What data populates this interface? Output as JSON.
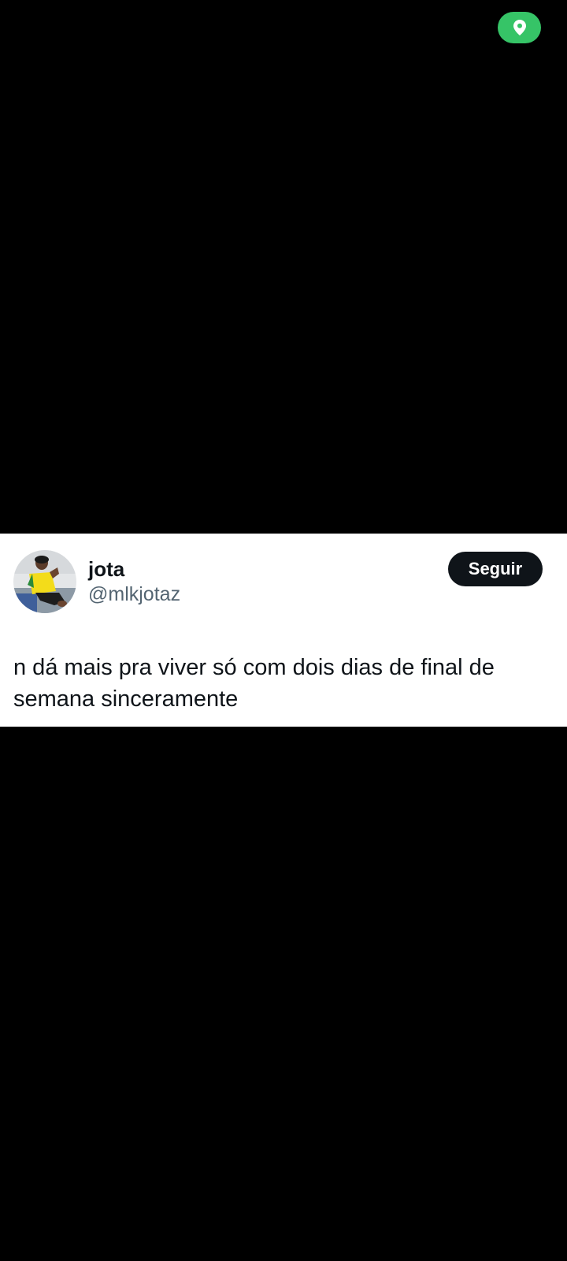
{
  "status": {
    "location_indicator_icon": "location-pin-icon",
    "accent_color": "#36c467"
  },
  "tweet": {
    "display_name": "jota",
    "handle": "@mlkjotaz",
    "follow_label": "Seguir",
    "text": "n dá mais pra viver só com dois dias de final de semana sinceramente",
    "avatar_icon": "profile-photo"
  }
}
